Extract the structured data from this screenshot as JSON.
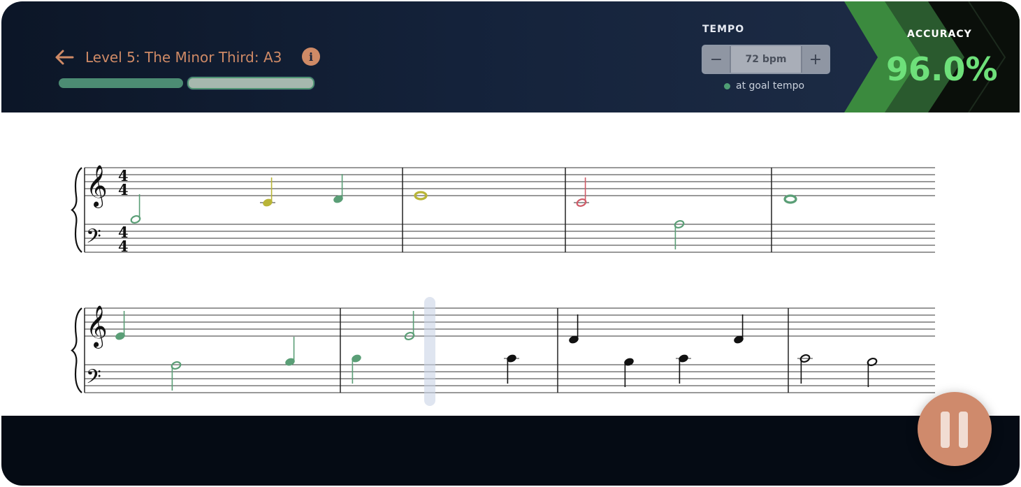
{
  "header": {
    "title": "Level 5: The Minor Third: A3",
    "info_icon": "info-icon",
    "back_icon": "arrow-left-icon",
    "progress": [
      {
        "state": "complete",
        "fraction": 1.0
      },
      {
        "state": "current",
        "fraction": 1.0
      }
    ]
  },
  "tempo": {
    "label": "TEMPO",
    "value": "72 bpm",
    "decrease_symbol": "−",
    "increase_symbol": "+",
    "status": "at goal tempo",
    "status_color": "#4f9e74"
  },
  "accuracy": {
    "label": "ACCURACY",
    "value": "96.0%",
    "value_color": "#6ee07a"
  },
  "score": {
    "time_signature": {
      "top": "4",
      "bottom": "4"
    },
    "note_colors": {
      "correct": "#5a9e76",
      "early_late": "#b9b538",
      "wrong": "#d05a67",
      "upcoming": "#111111"
    }
  },
  "colors": {
    "accent": "#cf8a66",
    "header_bg": "#14223a",
    "accuracy_green": "#3a8a3e"
  },
  "controls": {
    "pause_icon": "pause-icon"
  }
}
